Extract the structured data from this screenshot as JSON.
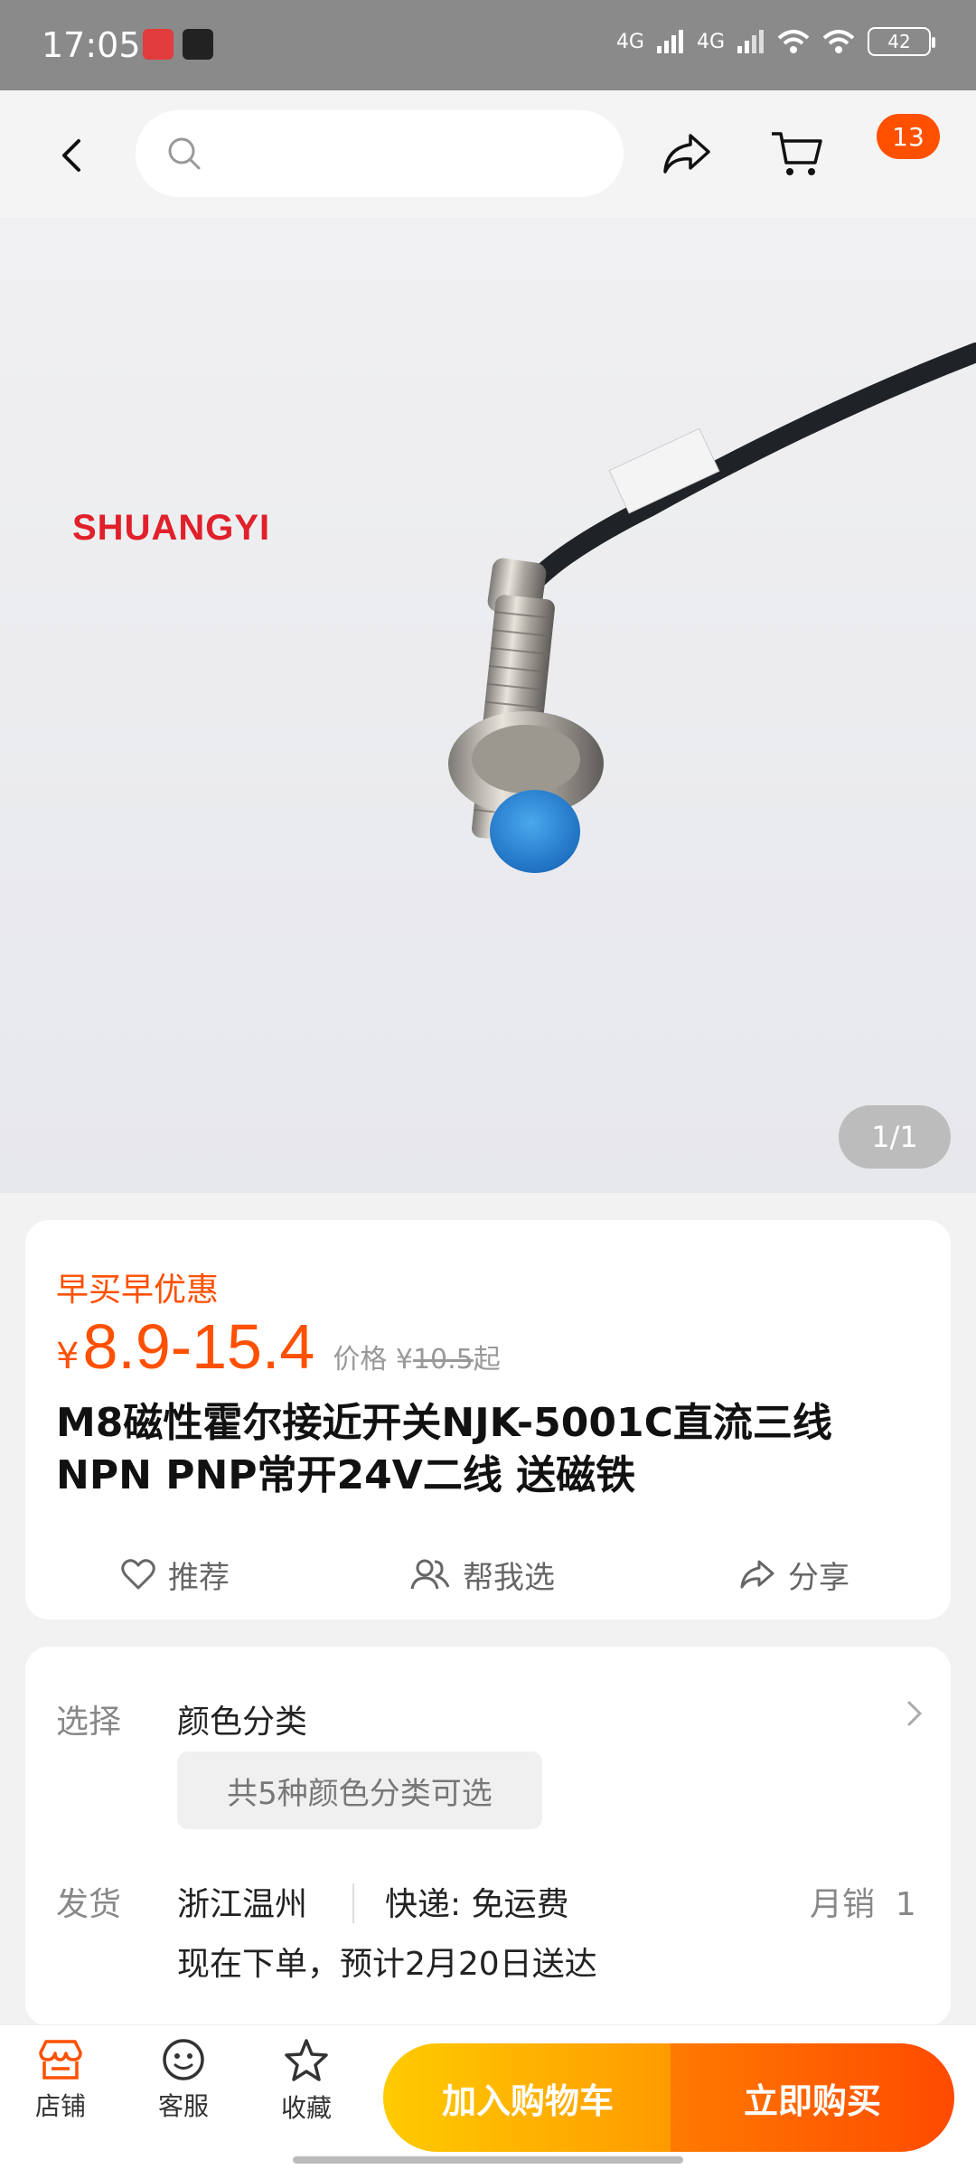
{
  "status_bar": {
    "time": "17:05",
    "network_1": "4G",
    "network_2": "4G",
    "battery": "42"
  },
  "nav": {
    "search_placeholder": "",
    "cart_badge": "13"
  },
  "gallery": {
    "brand_text": "SHUANGYI",
    "counter": "1/1"
  },
  "product": {
    "promo_label": "早买早优惠",
    "currency": "¥",
    "price_range": "8.9-15.4",
    "orig_prefix": "价格 ¥",
    "orig_price": "10.5",
    "orig_suffix": "起",
    "title": "M8磁性霍尔接近开关NJK-5001C直流三线NPN PNP常开24V二线 送磁铁",
    "actions": {
      "recommend": "推荐",
      "help_choose": "帮我选",
      "share": "分享"
    }
  },
  "options": {
    "select_label": "选择",
    "select_value": "颜色分类",
    "chip": "共5种颜色分类可选",
    "ship_label": "发货",
    "origin": "浙江温州",
    "express": "快递: 免运费",
    "monthly_sales": "月销  1",
    "delivery": "现在下单，预计2月20日送达"
  },
  "bottom": {
    "store": "店铺",
    "service": "客服",
    "favorite": "收藏",
    "add_to_cart": "加入购物车",
    "buy_now": "立即购买"
  },
  "colors": {
    "accent": "#ff5000",
    "status_bar": "#8a8a8a"
  }
}
